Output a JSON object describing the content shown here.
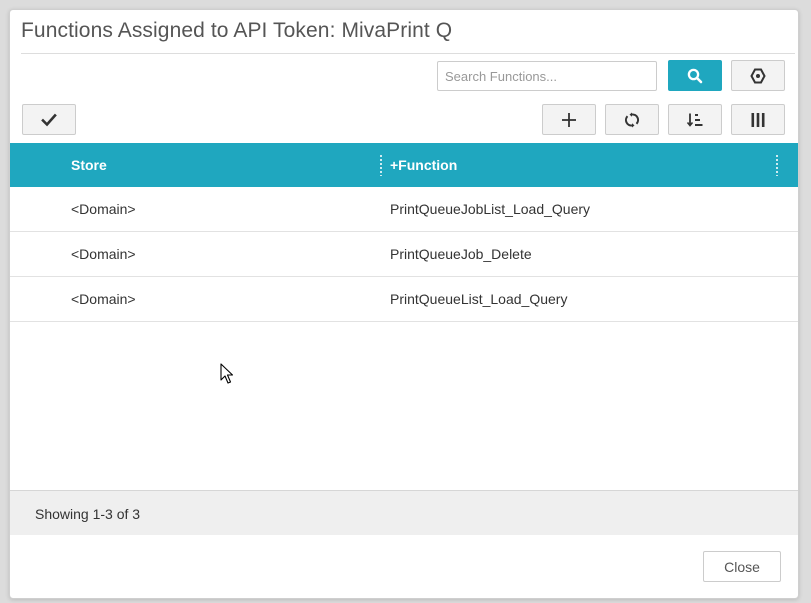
{
  "dialog": {
    "title": "Functions Assigned to API Token: MivaPrint Q"
  },
  "toolbar": {
    "search_placeholder": "Search Functions...",
    "search_value": "",
    "icons": {
      "search": "search-icon",
      "filter": "filter-icon",
      "select": "checkmark-icon",
      "add": "plus-icon",
      "refresh": "refresh-icon",
      "sort": "sort-icon",
      "columns": "columns-icon"
    }
  },
  "grid": {
    "header_color": "#1fa7bf",
    "columns": [
      "Store",
      "+Function"
    ],
    "rows": [
      {
        "store": "<Domain>",
        "function": "PrintQueueJobList_Load_Query"
      },
      {
        "store": "<Domain>",
        "function": "PrintQueueJob_Delete"
      },
      {
        "store": "<Domain>",
        "function": "PrintQueueList_Load_Query"
      }
    ]
  },
  "footer": {
    "status": "Showing 1-3 of 3",
    "close_label": "Close"
  }
}
